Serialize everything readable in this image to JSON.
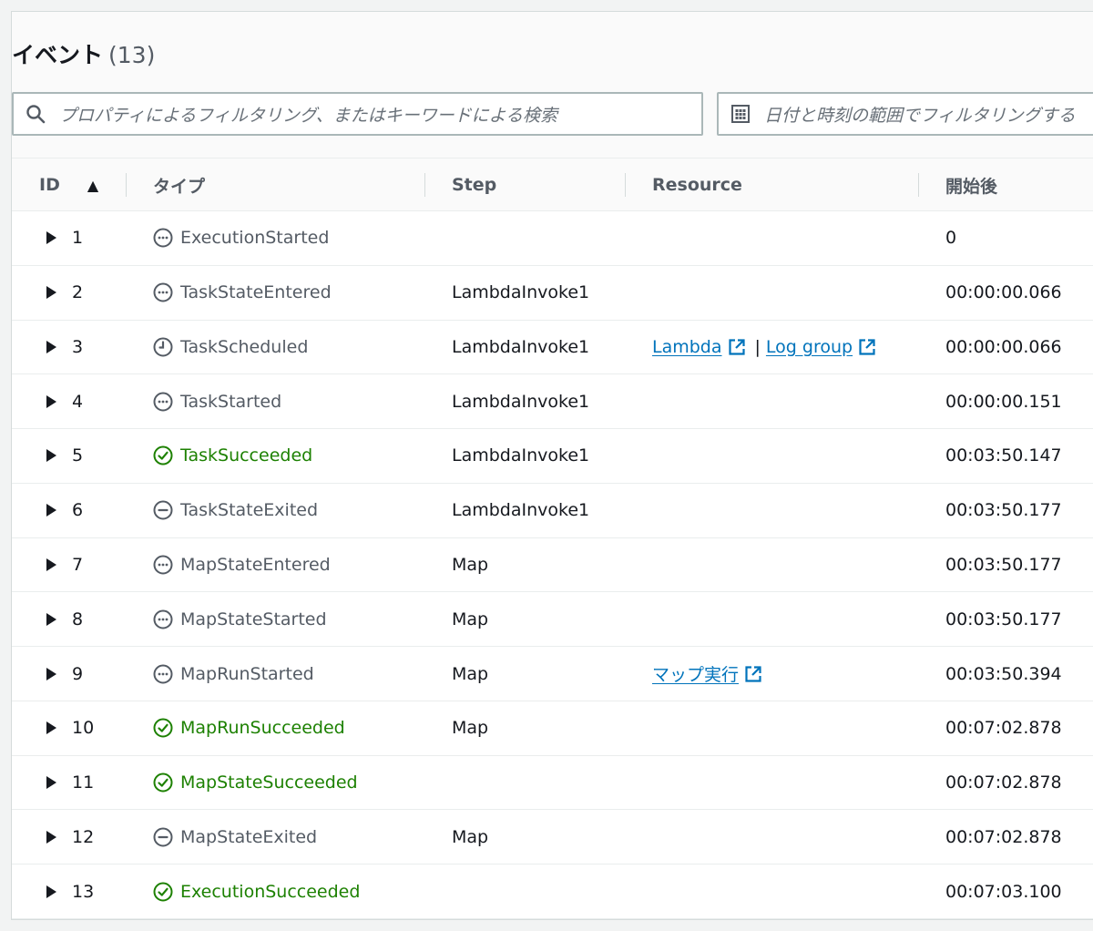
{
  "header": {
    "title": "イベント",
    "count": "(13)"
  },
  "filters": {
    "property_placeholder": "プロパティによるフィルタリング、またはキーワードによる検索",
    "date_placeholder": "日付と時刻の範囲でフィルタリングする"
  },
  "columns": {
    "id": "ID",
    "type": "タイプ",
    "step": "Step",
    "resource": "Resource",
    "elapsed": "開始後"
  },
  "resource_links": {
    "lambda": "Lambda",
    "separator": "|",
    "log_group": "Log group",
    "map_run": "マップ実行"
  },
  "colors": {
    "success": "#1d8102",
    "neutral": "#545b64",
    "link": "#0073bb"
  },
  "events": [
    {
      "id": "1",
      "type": "ExecutionStarted",
      "status": "info",
      "step": "",
      "resource": "none",
      "time": "0"
    },
    {
      "id": "2",
      "type": "TaskStateEntered",
      "status": "info",
      "step": "LambdaInvoke1",
      "resource": "none",
      "time": "00:00:00.066"
    },
    {
      "id": "3",
      "type": "TaskScheduled",
      "status": "scheduled",
      "step": "LambdaInvoke1",
      "resource": "lambda",
      "time": "00:00:00.066"
    },
    {
      "id": "4",
      "type": "TaskStarted",
      "status": "info",
      "step": "LambdaInvoke1",
      "resource": "none",
      "time": "00:00:00.151"
    },
    {
      "id": "5",
      "type": "TaskSucceeded",
      "status": "success",
      "step": "LambdaInvoke1",
      "resource": "none",
      "time": "00:03:50.147"
    },
    {
      "id": "6",
      "type": "TaskStateExited",
      "status": "exited",
      "step": "LambdaInvoke1",
      "resource": "none",
      "time": "00:03:50.177"
    },
    {
      "id": "7",
      "type": "MapStateEntered",
      "status": "info",
      "step": "Map",
      "resource": "none",
      "time": "00:03:50.177"
    },
    {
      "id": "8",
      "type": "MapStateStarted",
      "status": "info",
      "step": "Map",
      "resource": "none",
      "time": "00:03:50.177"
    },
    {
      "id": "9",
      "type": "MapRunStarted",
      "status": "info",
      "step": "Map",
      "resource": "map_run",
      "time": "00:03:50.394"
    },
    {
      "id": "10",
      "type": "MapRunSucceeded",
      "status": "success",
      "step": "Map",
      "resource": "none",
      "time": "00:07:02.878"
    },
    {
      "id": "11",
      "type": "MapStateSucceeded",
      "status": "success",
      "step": "",
      "resource": "none",
      "time": "00:07:02.878"
    },
    {
      "id": "12",
      "type": "MapStateExited",
      "status": "exited",
      "step": "Map",
      "resource": "none",
      "time": "00:07:02.878"
    },
    {
      "id": "13",
      "type": "ExecutionSucceeded",
      "status": "success",
      "step": "",
      "resource": "none",
      "time": "00:07:03.100"
    }
  ]
}
